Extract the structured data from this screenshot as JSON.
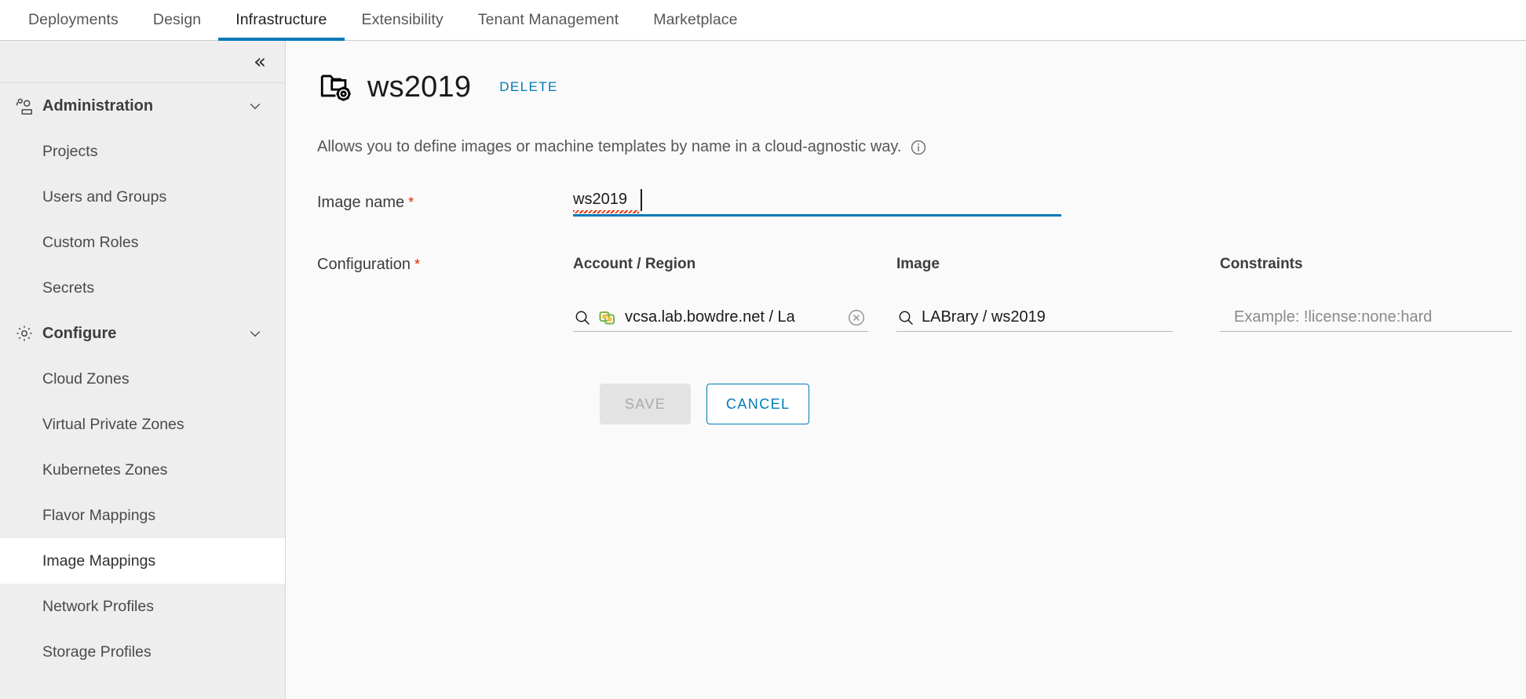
{
  "topnav": {
    "tabs": [
      {
        "label": "Deployments",
        "active": false
      },
      {
        "label": "Design",
        "active": false
      },
      {
        "label": "Infrastructure",
        "active": true
      },
      {
        "label": "Extensibility",
        "active": false
      },
      {
        "label": "Tenant Management",
        "active": false
      },
      {
        "label": "Marketplace",
        "active": false
      }
    ],
    "active_underline_color": "#0079b8"
  },
  "sidebar": {
    "collapse_icon": "double-chevron-left-icon",
    "groups": [
      {
        "label": "Administration",
        "icon": "users-icon",
        "chevron": "chevron-down-icon",
        "items": [
          {
            "label": "Projects",
            "selected": false
          },
          {
            "label": "Users and Groups",
            "selected": false
          },
          {
            "label": "Custom Roles",
            "selected": false
          },
          {
            "label": "Secrets",
            "selected": false
          }
        ]
      },
      {
        "label": "Configure",
        "icon": "gear-icon",
        "chevron": "chevron-down-icon",
        "items": [
          {
            "label": "Cloud Zones",
            "selected": false
          },
          {
            "label": "Virtual Private Zones",
            "selected": false
          },
          {
            "label": "Kubernetes Zones",
            "selected": false
          },
          {
            "label": "Flavor Mappings",
            "selected": false
          },
          {
            "label": "Image Mappings",
            "selected": true
          },
          {
            "label": "Network Profiles",
            "selected": false
          },
          {
            "label": "Storage Profiles",
            "selected": false
          }
        ]
      }
    ]
  },
  "page": {
    "title": "ws2019",
    "title_icon": "image-mapping-icon",
    "delete_label": "DELETE",
    "description": "Allows you to define images or machine templates by name in a cloud-agnostic way.",
    "info_icon": "info-circle-icon"
  },
  "form": {
    "image_name": {
      "label": "Image name",
      "required_marker": "*",
      "value": "ws2019",
      "placeholder": ""
    },
    "configuration": {
      "label": "Configuration",
      "required_marker": "*",
      "columns": {
        "account_region": "Account / Region",
        "image": "Image",
        "constraints": "Constraints"
      },
      "rows": [
        {
          "account_region": {
            "value": "vcsa.lab.bowdre.net / La",
            "search_icon": "search-icon",
            "provider_icon": "vsphere-icon",
            "clear_icon": "clear-circle-icon"
          },
          "image": {
            "value": "LABrary / ws2019",
            "search_icon": "search-icon"
          },
          "constraints": {
            "value": "",
            "placeholder": "Example: !license:none:hard"
          }
        }
      ]
    }
  },
  "actions": {
    "save_label": "SAVE",
    "cancel_label": "CANCEL"
  },
  "colors": {
    "accent_blue": "#0079b8",
    "required_red": "#e62700",
    "sidebar_bg": "#eeeeee",
    "content_bg": "#fafafa",
    "vsphere_green": "#7ab648",
    "vsphere_yellow": "#f5c242"
  }
}
